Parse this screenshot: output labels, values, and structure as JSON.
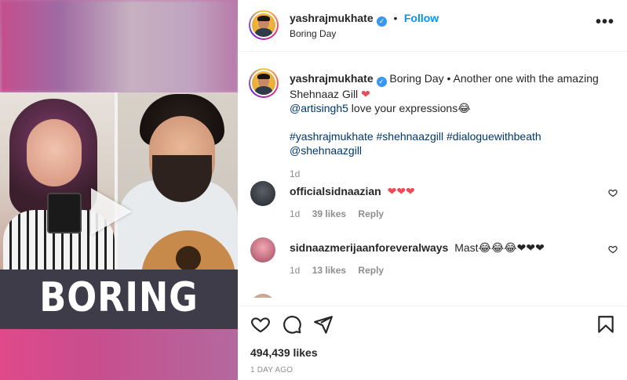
{
  "media": {
    "title_overlay": "BORING DAY"
  },
  "header": {
    "username": "yashrajmukhate",
    "follow_label": "Follow",
    "location": "Boring Day",
    "more_label": "•••",
    "verified_mark": "✓",
    "separator": "•"
  },
  "caption": {
    "username": "yashrajmukhate",
    "text_line1": "Boring Day • Another one with the amazing Shehnaaz Gill",
    "heart": "❤",
    "mention": "@artisingh5",
    "text_line2": " love your expressions😂",
    "hashtags": "#yashrajmukhate #shehnaazgill #dialoguewithbeath",
    "trailing_mention": "@shehnaazgill",
    "time": "1d"
  },
  "comments": [
    {
      "username": "officialsidnaazian",
      "text": "❤❤❤",
      "time": "1d",
      "likes": "39 likes",
      "reply_label": "Reply"
    },
    {
      "username": "sidnaazmerijaanforeveralways",
      "text": "Mast😂😂😂❤❤❤",
      "time": "1d",
      "likes": "13 likes",
      "reply_label": "Reply"
    }
  ],
  "footer": {
    "likes": "494,439 likes",
    "date": "1 DAY AGO"
  },
  "icons": {
    "like": "heart-outline-icon",
    "comment": "comment-icon",
    "share": "paper-plane-icon",
    "save": "bookmark-icon"
  },
  "colors": {
    "accent": "#0095f6",
    "heart": "#ed4956",
    "hashtag": "#00376b",
    "muted": "#8e8e8e"
  }
}
